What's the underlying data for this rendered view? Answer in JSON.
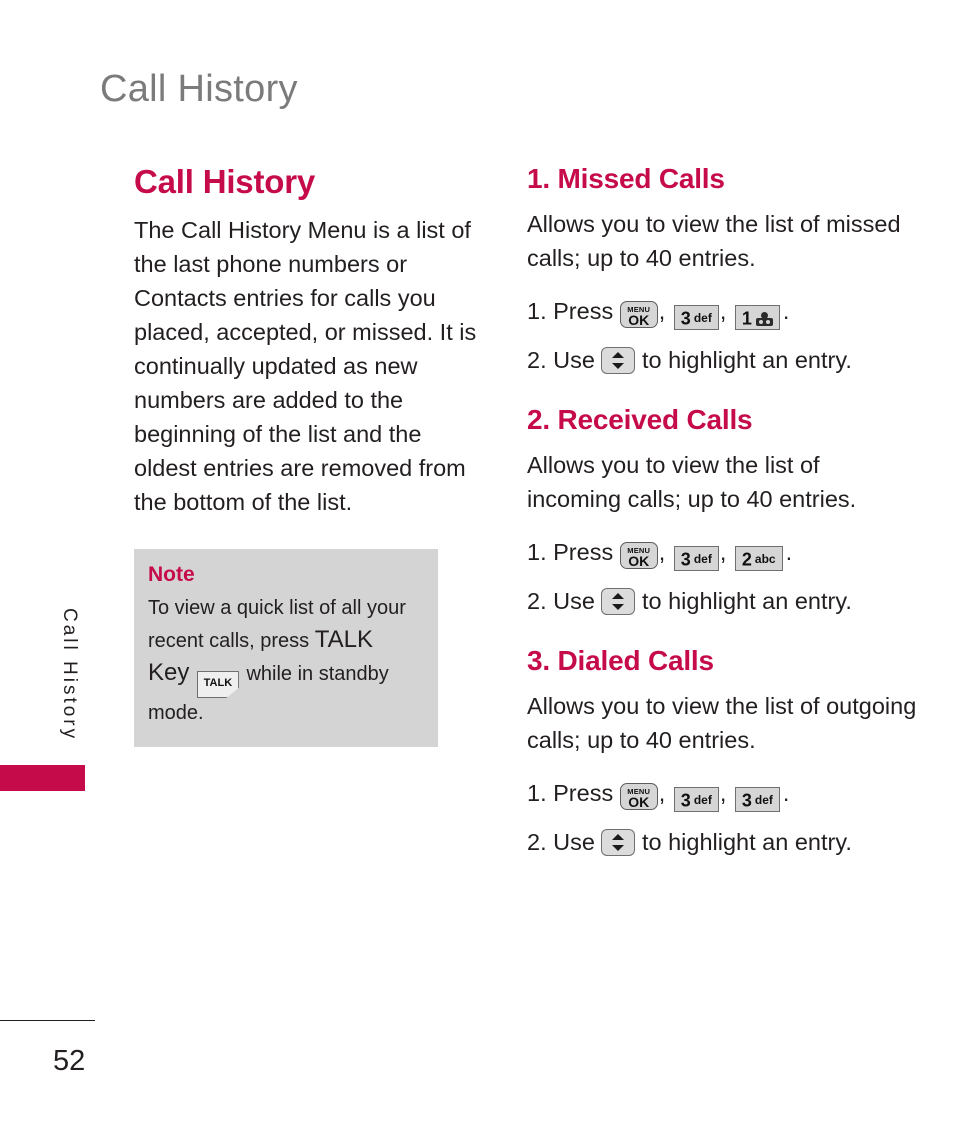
{
  "running_head": "Call History",
  "side_tab": {
    "label": "Call History",
    "accent_color": "#c60b4b"
  },
  "footer": {
    "page_number": "52"
  },
  "left_column": {
    "title": "Call History",
    "body": "The Call History Menu is a list of the last phone numbers or Contacts entries for calls you placed, accepted, or missed. It is continually updated as new numbers are added to the beginning of the list and the oldest entries are removed from the bottom of the list.",
    "note": {
      "title": "Note",
      "text_before": "To view a quick list of all your recent calls, press ",
      "talk_word": "TALK Key",
      "talk_key_label": "TALK",
      "text_after": " while in standby mode."
    }
  },
  "right_column": {
    "sections": [
      {
        "title": "1. Missed Calls",
        "body": "Allows you to view the list of missed calls; up to 40 entries.",
        "step1_prefix": "1. Press",
        "step2_prefix": "2. Use",
        "step2_suffix": "to highlight an entry.",
        "keys": [
          {
            "type": "menu-ok",
            "menu": "MENU",
            "ok": "OK"
          },
          {
            "type": "num",
            "digit": "3",
            "letters": "def"
          },
          {
            "type": "num-voicemail",
            "digit": "1",
            "letters": ""
          }
        ]
      },
      {
        "title": "2. Received Calls",
        "body": "Allows you to view the list of incoming calls; up to 40 entries.",
        "step1_prefix": "1. Press",
        "step2_prefix": "2. Use",
        "step2_suffix": "to highlight an entry.",
        "keys": [
          {
            "type": "menu-ok",
            "menu": "MENU",
            "ok": "OK"
          },
          {
            "type": "num",
            "digit": "3",
            "letters": "def"
          },
          {
            "type": "num",
            "digit": "2",
            "letters": "abc"
          }
        ]
      },
      {
        "title": "3. Dialed Calls",
        "body": "Allows you to view the list of outgoing calls; up to 40 entries.",
        "step1_prefix": "1. Press",
        "step2_prefix": "2.  Use",
        "step2_suffix": "to highlight an entry.",
        "keys": [
          {
            "type": "menu-ok",
            "menu": "MENU",
            "ok": "OK"
          },
          {
            "type": "num",
            "digit": "3",
            "letters": "def"
          },
          {
            "type": "num",
            "digit": "3",
            "letters": "def"
          }
        ]
      }
    ],
    "punctuation": {
      "comma": ",",
      "period": "."
    }
  }
}
